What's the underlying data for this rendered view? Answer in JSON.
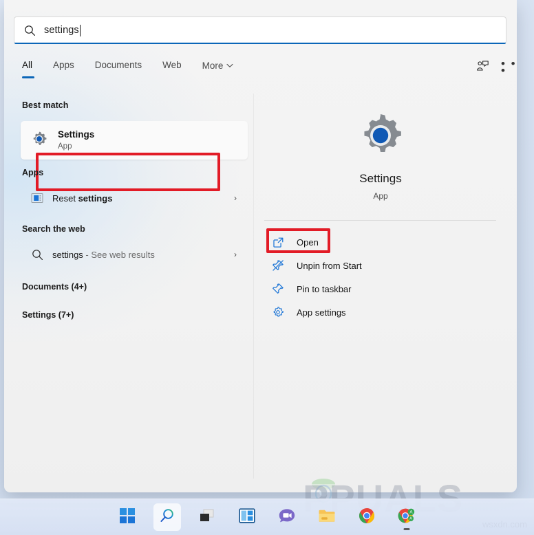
{
  "search": {
    "value": "settings",
    "icon": "search-icon"
  },
  "tabs": [
    {
      "label": "All",
      "active": true
    },
    {
      "label": "Apps",
      "active": false
    },
    {
      "label": "Documents",
      "active": false
    },
    {
      "label": "Web",
      "active": false
    },
    {
      "label": "More",
      "active": false,
      "chevron": "⌄"
    }
  ],
  "header_actions": {
    "feedback_icon": "feedback-person-icon",
    "more_label": "• • •"
  },
  "results": {
    "best_match_heading": "Best match",
    "best_match": {
      "title": "Settings",
      "subtitle": "App",
      "icon": "settings-gear-icon"
    },
    "apps_heading": "Apps",
    "apps": [
      {
        "label_regular": "Reset ",
        "label_bold": "settings",
        "icon": "control-panel-icon",
        "chevron": "›"
      }
    ],
    "web_heading": "Search the web",
    "web": [
      {
        "label_regular": "settings",
        "label_muted": " - See web results",
        "icon": "search-icon",
        "chevron": "›"
      }
    ],
    "documents_heading": "Documents (4+)",
    "settings_heading": "Settings (7+)"
  },
  "preview": {
    "title": "Settings",
    "subtitle": "App",
    "icon": "settings-gear-icon",
    "actions": [
      {
        "label": "Open",
        "icon": "open-external-icon"
      },
      {
        "label": "Unpin from Start",
        "icon": "unpin-icon"
      },
      {
        "label": "Pin to taskbar",
        "icon": "pin-icon"
      },
      {
        "label": "App settings",
        "icon": "gear-icon"
      }
    ]
  },
  "taskbar": {
    "items": [
      {
        "name": "start-button",
        "label": "Start",
        "active": false
      },
      {
        "name": "search-button",
        "label": "Search",
        "active": true
      },
      {
        "name": "task-view-button",
        "label": "Task View",
        "active": false
      },
      {
        "name": "widgets-button",
        "label": "Widgets",
        "active": false
      },
      {
        "name": "chat-button",
        "label": "Chat",
        "active": false
      },
      {
        "name": "file-explorer-button",
        "label": "File Explorer",
        "active": false
      },
      {
        "name": "chrome-button",
        "label": "Google Chrome",
        "active": false
      },
      {
        "name": "chrome-app-button",
        "label": "Chrome App",
        "active": false
      }
    ]
  },
  "watermarks": {
    "appuals": "PPUALS",
    "wsxdn": "wsxdn.com"
  },
  "colors": {
    "accent": "#0b66b8",
    "annotation": "#e21b26",
    "panel_bg": "#f2f2f2"
  }
}
